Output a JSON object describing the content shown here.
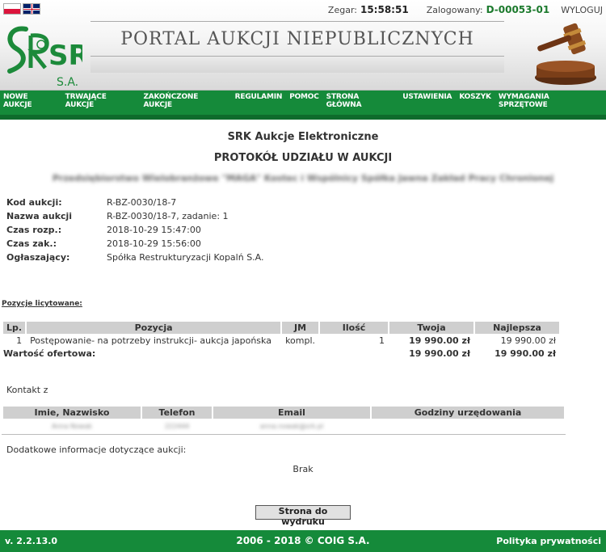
{
  "header": {
    "clock_label": "Zegar:",
    "clock_value": "15:58:51",
    "logged_label": "Zalogowany:",
    "logged_user": "D-00053-01",
    "logout": "WYLOGUJ",
    "banner": "PORTAL AUKCJI NIEPUBLICZNYCH",
    "logo_main": "SRK",
    "logo_sub": "S.A."
  },
  "nav": [
    "NOWE AUKCJE",
    "TRWAJĄCE AUKCJE",
    "ZAKOŃCZONE AUKCJE",
    "REGULAMIN",
    "POMOC",
    "STRONA GŁÓWNA",
    "USTAWIENIA",
    "KOSZYK",
    "WYMAGANIA SPRZĘTOWE"
  ],
  "main": {
    "title": "SRK Aukcje Elektroniczne",
    "subtitle": "PROTOKÓŁ UDZIAŁU W AUKCJI",
    "company_blurred": "Przedsiębiorstwo Wielobranżowe \"MAGA\" Kostec i Wspólnicy Spółka Jawna Zakład Pracy Chronionej",
    "info": [
      {
        "label": "Kod aukcji:",
        "value": "R-BZ-0030/18-7"
      },
      {
        "label": "Nazwa aukcji",
        "value": "R-BZ-0030/18-7, zadanie: 1"
      },
      {
        "label": "Czas rozp.:",
        "value": "2018-10-29 15:47:00"
      },
      {
        "label": "Czas zak.:",
        "value": "2018-10-29 15:56:00"
      },
      {
        "label": "Ogłaszający:",
        "value": "Spółka Restrukturyzacji Kopalń S.A."
      }
    ],
    "positions_label": "Pozycje licytowane:",
    "table": {
      "headers": [
        "Lp.",
        "Pozycja",
        "JM",
        "Ilość",
        "Twoja",
        "Najlepsza"
      ],
      "row": [
        "1",
        "Postępowanie- na potrzeby instrukcji- aukcja japońska",
        "kompl.",
        "1",
        "19 990.00 zł",
        "19 990.00 zł"
      ],
      "total_label": "Wartość ofertowa:",
      "total_yours": "19 990.00 zł",
      "total_best": "19 990.00 zł"
    },
    "contact_label": "Kontakt z",
    "contact_table": {
      "headers": [
        "Imie, Nazwisko",
        "Telefon",
        "Email",
        "Godziny urzędowania"
      ],
      "row": [
        "Anna Nowak",
        "222444",
        "anna.nowak@srk.pl",
        ""
      ]
    },
    "extra_label": "Dodatkowe informacje dotyczące aukcji:",
    "extra_value": "Brak",
    "print_button": "Strona do wydruku"
  },
  "footer": {
    "version": "v. 2.2.13.0",
    "copyright": "2006 - 2018 © COIG S.A.",
    "privacy": "Polityka prywatności"
  }
}
